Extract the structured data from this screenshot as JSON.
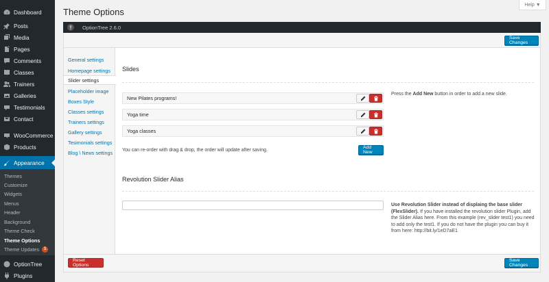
{
  "sidebar": {
    "items": [
      {
        "label": "Dashboard",
        "icon": "dashboard-icon"
      },
      {
        "label": "Posts",
        "icon": "pin-icon"
      },
      {
        "label": "Media",
        "icon": "media-icon"
      },
      {
        "label": "Pages",
        "icon": "pages-icon"
      },
      {
        "label": "Comments",
        "icon": "comments-icon"
      },
      {
        "label": "Classes",
        "icon": "book-icon"
      },
      {
        "label": "Trainers",
        "icon": "users-icon"
      },
      {
        "label": "Galleries",
        "icon": "gallery-icon"
      },
      {
        "label": "Testimonials",
        "icon": "quote-icon"
      },
      {
        "label": "Contact",
        "icon": "contact-icon"
      },
      {
        "label": "WooCommerce",
        "icon": "woocommerce-icon"
      },
      {
        "label": "Products",
        "icon": "products-icon"
      },
      {
        "label": "Appearance",
        "icon": "brush-icon"
      },
      {
        "label": "OptionTree",
        "icon": "optiontree-icon"
      },
      {
        "label": "Plugins",
        "icon": "plugin-icon"
      }
    ],
    "submenu": [
      {
        "label": "Themes"
      },
      {
        "label": "Customize"
      },
      {
        "label": "Widgets"
      },
      {
        "label": "Menus"
      },
      {
        "label": "Header"
      },
      {
        "label": "Background"
      },
      {
        "label": "Theme Check"
      },
      {
        "label": "Theme Options"
      },
      {
        "label": "Theme Updates",
        "badge": "1"
      }
    ]
  },
  "header": {
    "title": "Theme Options",
    "help_label": "Help ▼"
  },
  "optiontree": {
    "version_label": "OptionTree 2.6.0"
  },
  "toolbar": {
    "save_label": "Save Changes",
    "reset_label": "Reset Options"
  },
  "tabs": [
    {
      "label": "General settings"
    },
    {
      "label": "Homepage settings"
    },
    {
      "label": "Slider settings"
    },
    {
      "label": "Placeholder image"
    },
    {
      "label": "Boxes Style"
    },
    {
      "label": "Classes settings"
    },
    {
      "label": "Trainers settings"
    },
    {
      "label": "Gallery settings"
    },
    {
      "label": "Tesimonials settings"
    },
    {
      "label": "Blog \\ News settings"
    }
  ],
  "slides": {
    "title": "Slides",
    "items": [
      {
        "title": "New Pilates programs!"
      },
      {
        "title": "Yoga time"
      },
      {
        "title": "Yoga classes"
      }
    ],
    "hint_prefix": "Press the ",
    "hint_bold": "Add New",
    "hint_suffix": " button in order to add a new slide.",
    "reorder_note": "You can re-order with drag & drop, the order will update after saving.",
    "add_label": "Add New"
  },
  "revolution": {
    "title": "Revolution Slider Alias",
    "input_value": "",
    "desc_bold": "Use Revolution Slider instead of displaing the base slider (FlexSlider).",
    "desc_text": " If you have installed the revolution slider Plugin, add the Slider Alias here. From this example (rev_slider test1) you need to add only the test1. If you do not have the plugin you can buy it from here: http://bit.ly/1eD7aE1"
  },
  "colors": {
    "sidebar_bg": "#23282d",
    "accent": "#0073aa",
    "button_blue": "#0085ba",
    "button_red": "#c9302c"
  }
}
